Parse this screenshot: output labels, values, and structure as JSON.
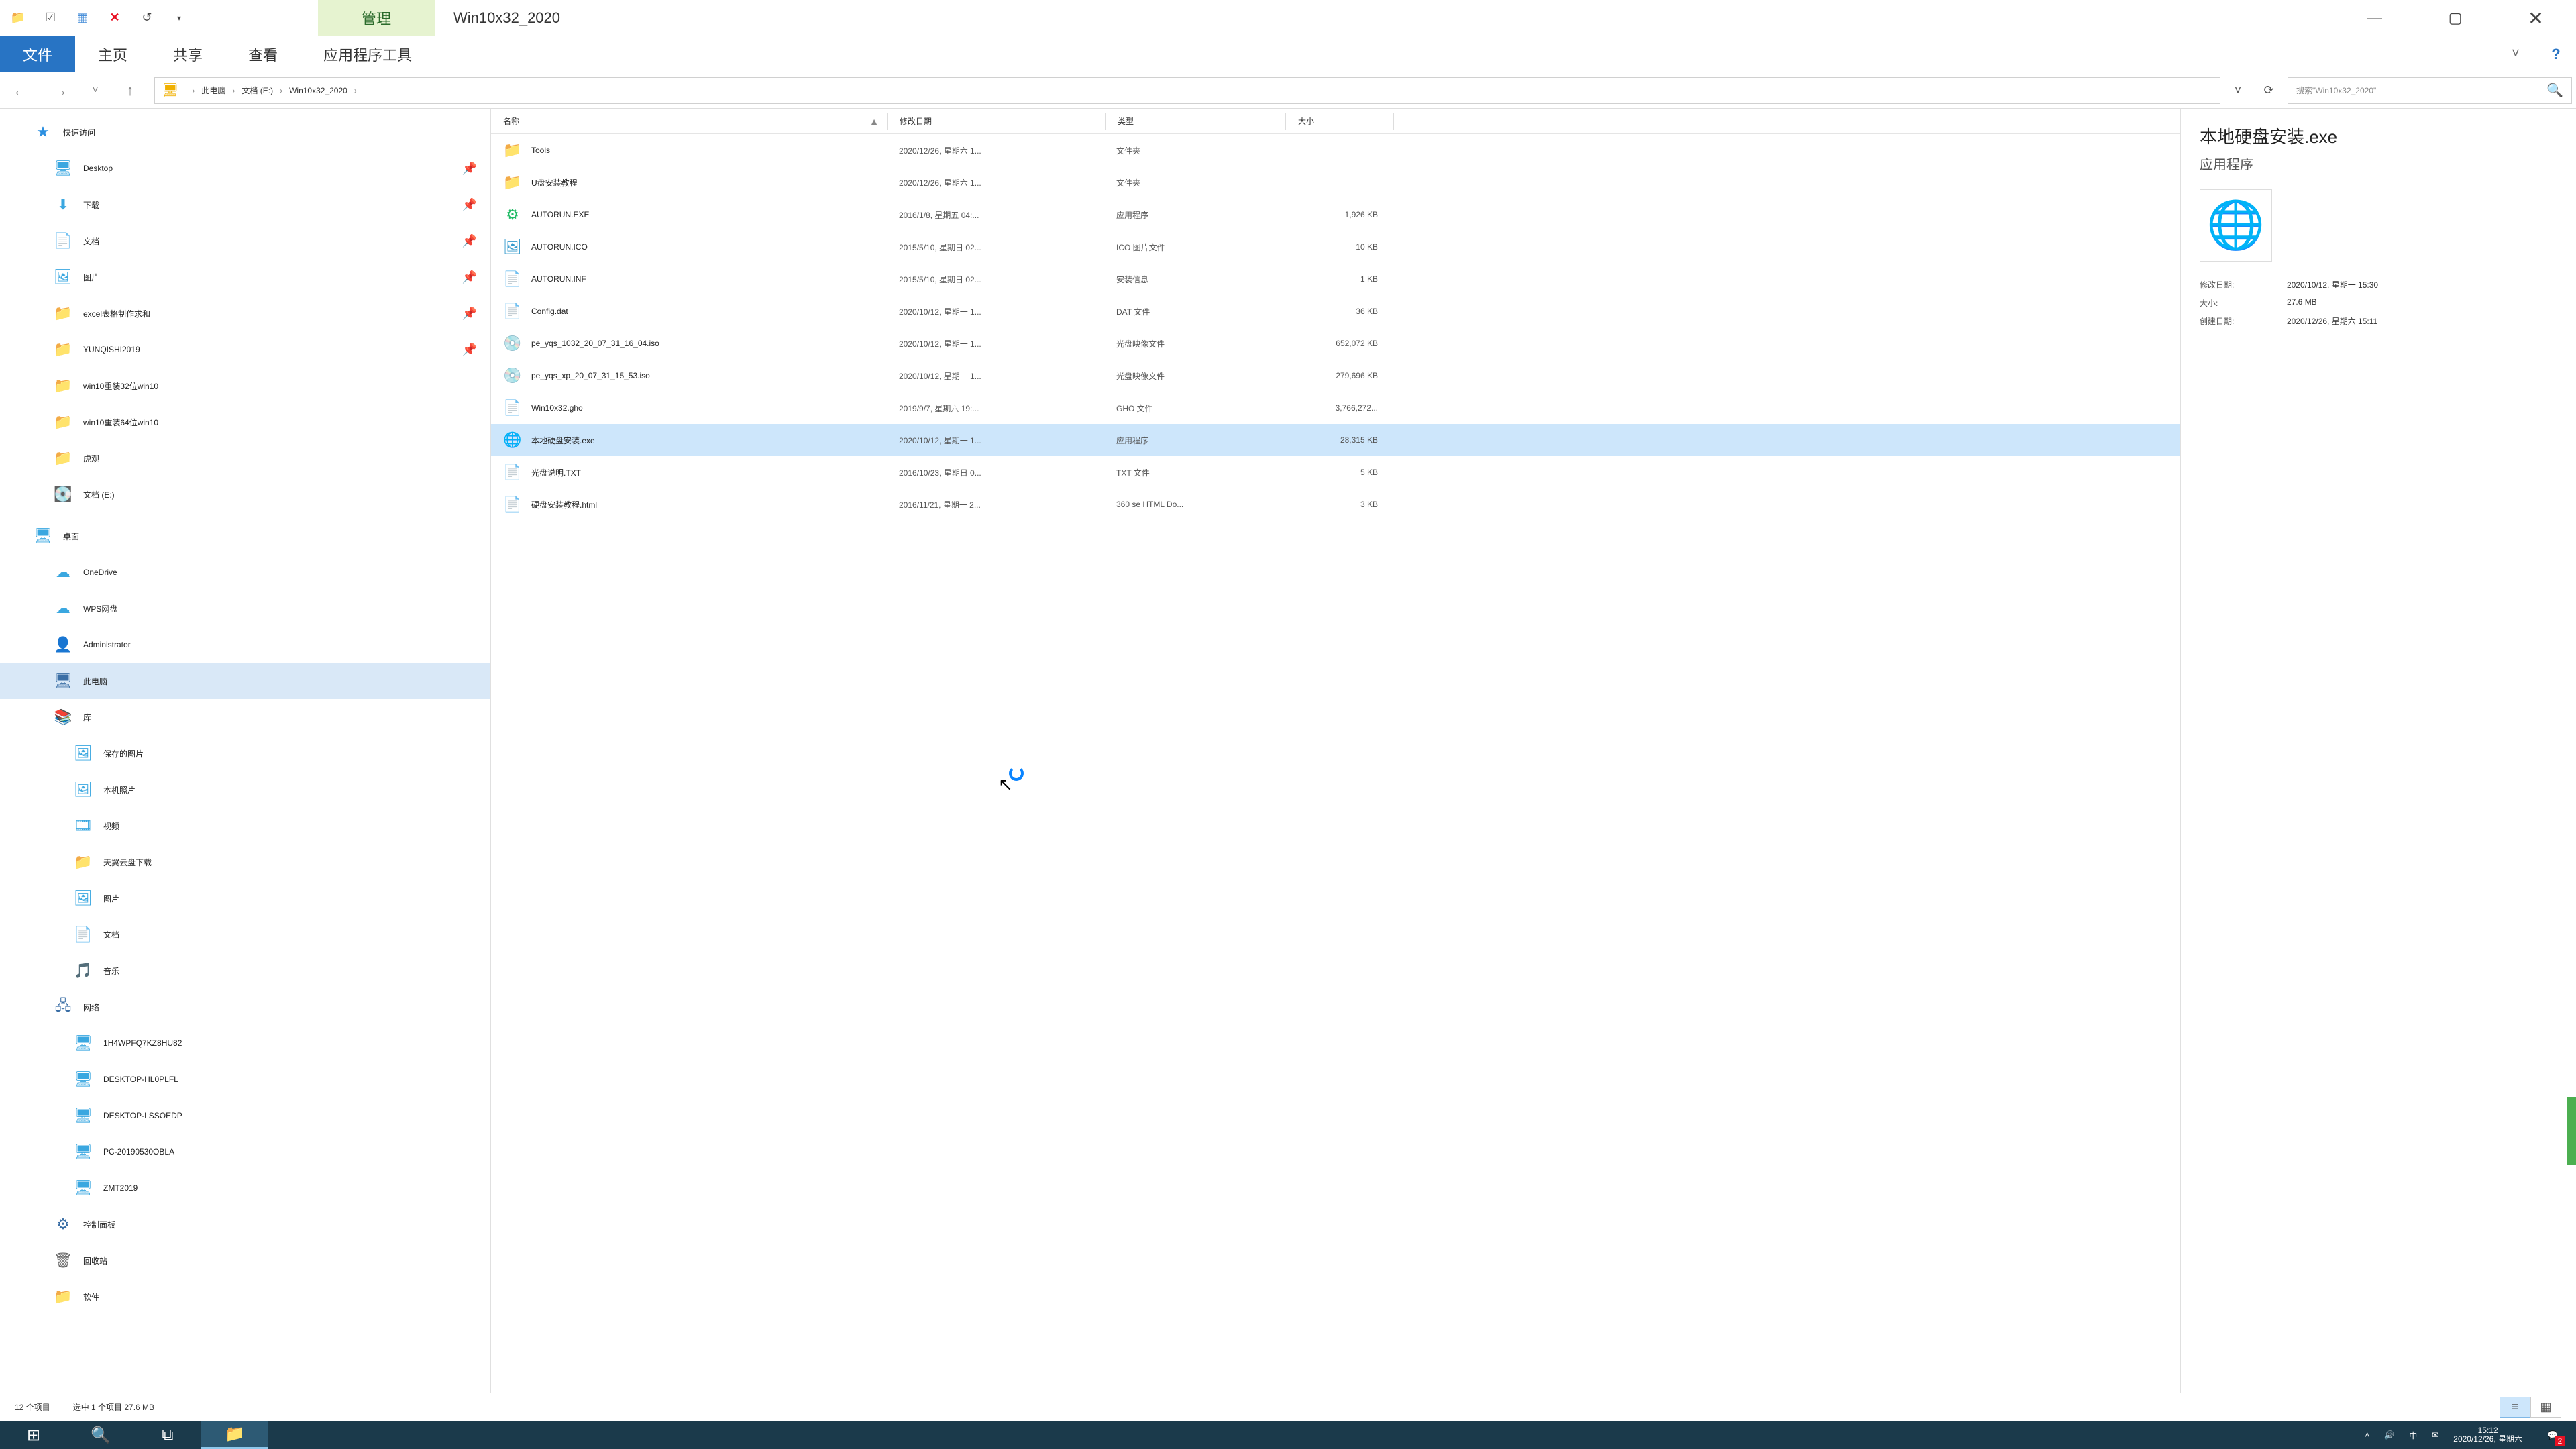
{
  "title": {
    "manage": "管理",
    "folder": "Win10x32_2020"
  },
  "ribbon": {
    "file": "文件",
    "home": "主页",
    "share": "共享",
    "view": "查看",
    "apptools": "应用程序工具"
  },
  "breadcrumb": {
    "segments": [
      "此电脑",
      "文档 (E:)",
      "Win10x32_2020"
    ]
  },
  "search": {
    "placeholder": "搜索\"Win10x32_2020\""
  },
  "sidebar": {
    "quick_access": "快速访问",
    "desktop": "Desktop",
    "downloads": "下载",
    "documents": "文档",
    "pictures": "图片",
    "excel_make": "excel表格制作求和",
    "yunqishi": "YUNQISHI2019",
    "win10_32": "win10重装32位win10",
    "win10_64": "win10重装64位win10",
    "huguan": "虎观",
    "doc_e": "文档 (E:)",
    "desktop2": "桌面",
    "onedrive": "OneDrive",
    "wps": "WPS网盘",
    "admin": "Administrator",
    "this_pc": "此电脑",
    "libraries": "库",
    "saved_pic": "保存的图片",
    "local_pic": "本机照片",
    "video": "视频",
    "tianyi": "天翼云盘下载",
    "lib_pic": "图片",
    "lib_doc": "文档",
    "lib_music": "音乐",
    "network": "网络",
    "n1": "1H4WPFQ7KZ8HU82",
    "n2": "DESKTOP-HL0PLFL",
    "n3": "DESKTOP-LSSOEDP",
    "n4": "PC-20190530OBLA",
    "n5": "ZMT2019",
    "control_panel": "控制面板",
    "recycle_bin": "回收站",
    "software": "软件"
  },
  "columns": {
    "name": "名称",
    "date": "修改日期",
    "type": "类型",
    "size": "大小"
  },
  "files": [
    {
      "icon": "folder",
      "name": "Tools",
      "date": "2020/12/26, 星期六 1...",
      "type": "文件夹",
      "size": ""
    },
    {
      "icon": "folder",
      "name": "U盘安装教程",
      "date": "2020/12/26, 星期六 1...",
      "type": "文件夹",
      "size": ""
    },
    {
      "icon": "exe",
      "name": "AUTORUN.EXE",
      "date": "2016/1/8, 星期五 04:...",
      "type": "应用程序",
      "size": "1,926 KB"
    },
    {
      "icon": "ico",
      "name": "AUTORUN.ICO",
      "date": "2015/5/10, 星期日 02...",
      "type": "ICO 图片文件",
      "size": "10 KB"
    },
    {
      "icon": "inf",
      "name": "AUTORUN.INF",
      "date": "2015/5/10, 星期日 02...",
      "type": "安装信息",
      "size": "1 KB"
    },
    {
      "icon": "dat",
      "name": "Config.dat",
      "date": "2020/10/12, 星期一 1...",
      "type": "DAT 文件",
      "size": "36 KB"
    },
    {
      "icon": "iso",
      "name": "pe_yqs_1032_20_07_31_16_04.iso",
      "date": "2020/10/12, 星期一 1...",
      "type": "光盘映像文件",
      "size": "652,072 KB"
    },
    {
      "icon": "iso",
      "name": "pe_yqs_xp_20_07_31_15_53.iso",
      "date": "2020/10/12, 星期一 1...",
      "type": "光盘映像文件",
      "size": "279,696 KB"
    },
    {
      "icon": "gho",
      "name": "Win10x32.gho",
      "date": "2019/9/7, 星期六 19:...",
      "type": "GHO 文件",
      "size": "3,766,272..."
    },
    {
      "icon": "app",
      "name": "本地硬盘安装.exe",
      "date": "2020/10/12, 星期一 1...",
      "type": "应用程序",
      "size": "28,315 KB",
      "selected": true
    },
    {
      "icon": "txt",
      "name": "光盘说明.TXT",
      "date": "2016/10/23, 星期日 0...",
      "type": "TXT 文件",
      "size": "5 KB"
    },
    {
      "icon": "html",
      "name": "硬盘安装教程.html",
      "date": "2016/11/21, 星期一 2...",
      "type": "360 se HTML Do...",
      "size": "3 KB"
    }
  ],
  "preview": {
    "name": "本地硬盘安装.exe",
    "subtype": "应用程序",
    "kv": {
      "mod_label": "修改日期:",
      "mod_val": "2020/10/12, 星期一 15:30",
      "size_label": "大小:",
      "size_val": "27.6 MB",
      "create_label": "创建日期:",
      "create_val": "2020/12/26, 星期六 15:11"
    }
  },
  "status": {
    "count": "12 个项目",
    "selection": "选中 1 个项目  27.6 MB"
  },
  "tray": {
    "ime": "中",
    "time": "15:12",
    "date": "2020/12/26, 星期六",
    "notif_count": "2"
  }
}
